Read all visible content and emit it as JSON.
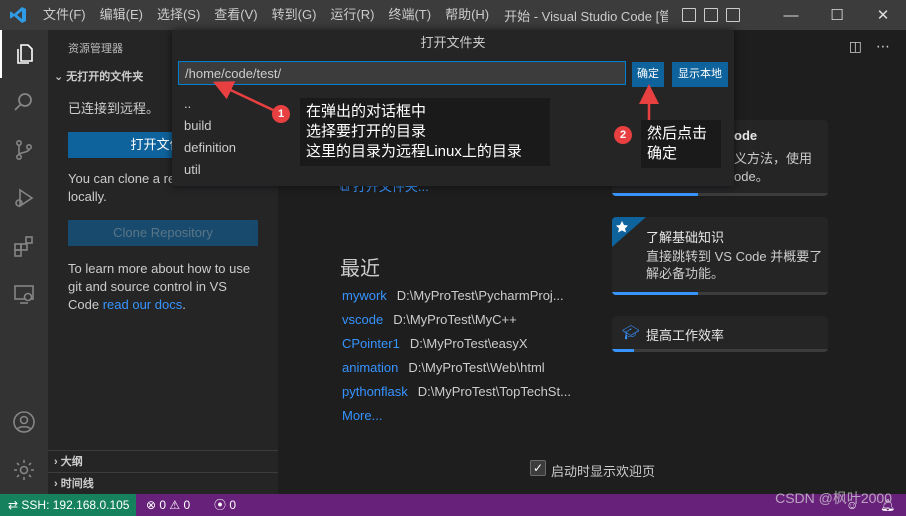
{
  "titlebar": {
    "menus": [
      "文件(F)",
      "编辑(E)",
      "选择(S)",
      "查看(V)",
      "转到(G)",
      "运行(R)",
      "终端(T)",
      "帮助(H)"
    ],
    "window_title": "开始 - Visual Studio Code [管...",
    "controls": {
      "minimize": "—",
      "maximize": "☐",
      "close": "✕"
    }
  },
  "sidebar": {
    "title": "资源管理器",
    "section": "无打开的文件夹",
    "connected_text": "已连接到远程。",
    "open_button": "打开文件夹",
    "clone_text_1": "You can clone a repository",
    "clone_text_2": "locally.",
    "clone_button": "Clone Repository",
    "learn_text_1": "To learn more about how to use",
    "learn_text_2": "git and source control in VS",
    "learn_text_3_prefix": "Code ",
    "learn_link": "read our docs",
    "learn_text_3_suffix": ".",
    "outline": "大纲",
    "timeline": "时间线"
  },
  "dialog": {
    "title": "打开文件夹",
    "input_value": "/home/code/test/",
    "ok_button": "确定",
    "show_local_button": "显示本地",
    "items": [
      "..",
      "build",
      "definition",
      "util"
    ]
  },
  "annotations": {
    "one": {
      "number": "1",
      "lines": [
        "在弹出的对话框中",
        "选择要打开的目录",
        "这里的目录为远程Linux上的目录"
      ]
    },
    "two": {
      "number": "2",
      "lines": [
        "然后点击",
        "确定"
      ]
    }
  },
  "welcome": {
    "open_folder_link": "打开文件夹...",
    "recent_title": "最近",
    "recent": [
      {
        "name": "mywork",
        "path": "D:\\MyProTest\\PycharmProj..."
      },
      {
        "name": "vscode",
        "path": "D:\\MyProTest\\MyC++"
      },
      {
        "name": "CPointer1",
        "path": "D:\\MyProTest\\easyX"
      },
      {
        "name": "animation",
        "path": "D:\\MyProTest\\Web\\html"
      },
      {
        "name": "pythonflask",
        "path": "D:\\MyProTest\\TopTechSt..."
      }
    ],
    "more": "More...",
    "cards": [
      {
        "title_fragment": "ode",
        "desc_1": "义方法，使用",
        "desc_2": "ode。",
        "progress": 0.4
      },
      {
        "title": "了解基础知识",
        "desc_1": "直接跳转到 VS Code 并概要了",
        "desc_2": "解必备功能。",
        "progress": 0.4
      },
      {
        "title": "提高工作效率",
        "progress": 0.1
      }
    ],
    "show_on_startup": "启动时显示欢迎页",
    "show_on_startup_checked": true
  },
  "statusbar": {
    "remote": "SSH: 192.168.0.105",
    "errors": "0",
    "warnings": "0",
    "ports": "0",
    "accent_color": "#68217a",
    "remote_color": "#16825d"
  },
  "watermark": "CSDN @枫叶2000"
}
